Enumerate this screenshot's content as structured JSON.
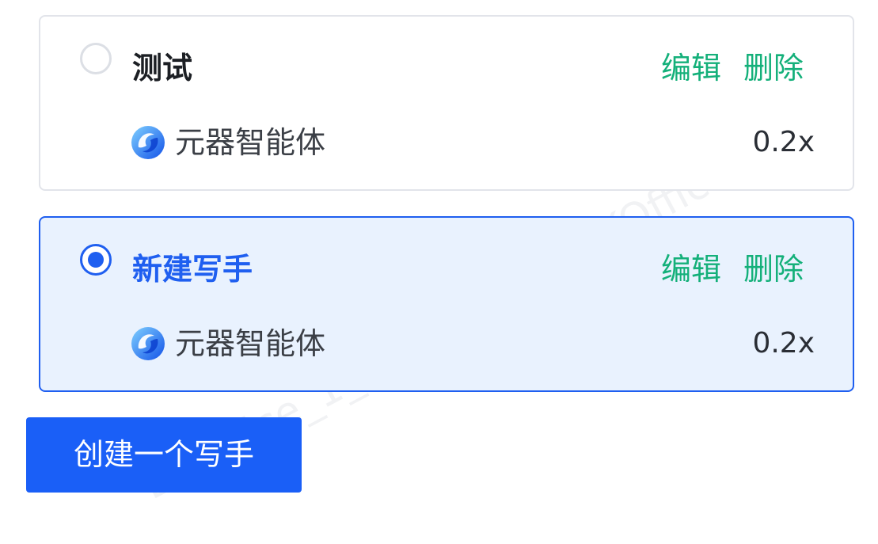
{
  "writers": [
    {
      "title": "测试",
      "selected": false,
      "edit_label": "编辑",
      "delete_label": "删除",
      "model_name": "元器智能体",
      "model_icon": "yuanqi-logo-icon",
      "rate": "0.2x"
    },
    {
      "title": "新建写手",
      "selected": true,
      "edit_label": "编辑",
      "delete_label": "删除",
      "model_name": "元器智能体",
      "model_icon": "yuanqi-logo-icon",
      "rate": "0.2x"
    }
  ],
  "create_button_label": "创建一个写手",
  "watermark_text": "BKOffice_1_1",
  "colors": {
    "accent": "#1f5ff0",
    "action": "#14b07a",
    "selected_bg": "#e9f2fe",
    "button": "#1a5ff7"
  }
}
